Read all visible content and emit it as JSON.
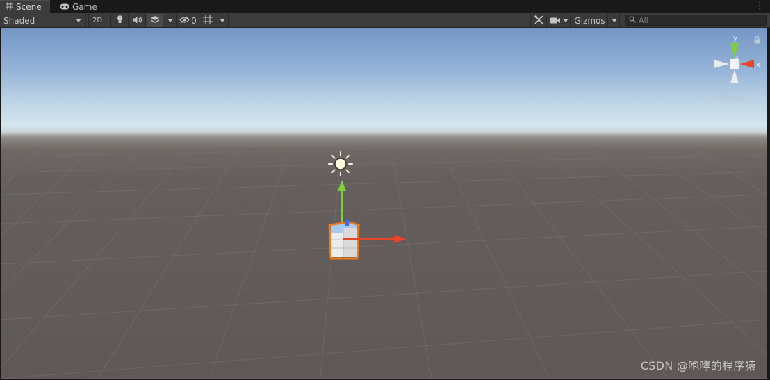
{
  "tabs": [
    {
      "label": "Scene",
      "icon": "grid-icon",
      "active": true
    },
    {
      "label": "Game",
      "icon": "gamepad-icon",
      "active": false
    }
  ],
  "toolbar": {
    "draw_mode": "Shaded",
    "two_d_label": "2D",
    "hidden_count": "0",
    "gizmos_label": "Gizmos",
    "search_placeholder": "All"
  },
  "view": {
    "projection_label": "Persp",
    "axis_labels": {
      "y": "y",
      "x": "x"
    }
  },
  "watermark": "CSDN @咆哮的程序猿",
  "colors": {
    "x_axis": "#e8442a",
    "y_axis": "#7fcf3a",
    "z_axis": "#3a6cf0",
    "selection_outline": "#f07a1e"
  }
}
